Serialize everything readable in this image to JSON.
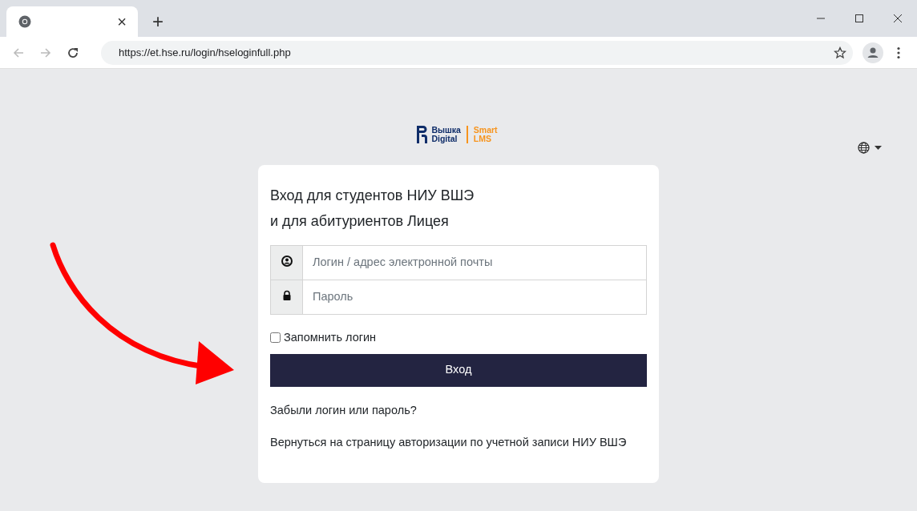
{
  "browser": {
    "tab": {
      "close": "×"
    },
    "new_tab": "+",
    "url": "https://et.hse.ru/login/hseloginfull.php"
  },
  "logo": {
    "line_1": "Вышка",
    "line_2": "Digital",
    "line_3": "Smart",
    "line_4": "LMS"
  },
  "login_card": {
    "title_lines": [
      "Вход для студентов НИУ ВШЭ",
      "и для абитуриентов Лицея"
    ],
    "fields": [
      {
        "kind": "user",
        "placeholder": "Логин / адрес электронной почты"
      },
      {
        "kind": "password",
        "placeholder": "Пароль"
      }
    ],
    "remember": {
      "label": "Запомнить логин",
      "checked": false
    },
    "submit": "Вход",
    "links": [
      "Забыли логин или пароль?",
      "Вернуться на страницу авторизации по учетной записи НИУ ВШЭ"
    ]
  }
}
